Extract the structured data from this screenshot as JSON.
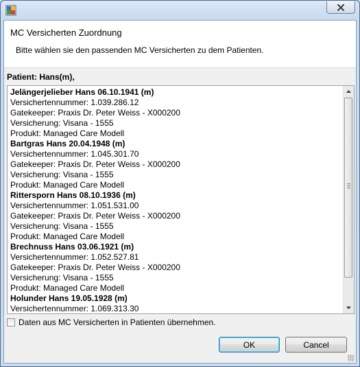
{
  "window": {
    "close_label": "×"
  },
  "header": {
    "title": "MC Versicherten Zuordnung",
    "message": "Bitte wählen sie den passenden MC Versicherten zu dem Patienten."
  },
  "patient": {
    "label": "Patient:  Hans(m),"
  },
  "list": {
    "lines": [
      {
        "text": "Jelängerjelieber Hans 06.10.1941 (m)",
        "bold": true
      },
      {
        "text": "Versichertennummer: 1.039.286.12",
        "bold": false
      },
      {
        "text": "Gatekeeper: Praxis Dr. Peter Weiss - X000200",
        "bold": false
      },
      {
        "text": "Versicherung: Visana - 1555",
        "bold": false
      },
      {
        "text": "Produkt: Managed Care Modell",
        "bold": false
      },
      {
        "text": "Bartgras Hans 20.04.1948 (m)",
        "bold": true
      },
      {
        "text": "Versichertennummer: 1.045.301.70",
        "bold": false
      },
      {
        "text": "Gatekeeper: Praxis Dr. Peter Weiss - X000200",
        "bold": false
      },
      {
        "text": "Versicherung: Visana - 1555",
        "bold": false
      },
      {
        "text": "Produkt: Managed Care Modell",
        "bold": false
      },
      {
        "text": "Rittersporn Hans 08.10.1936 (m)",
        "bold": true
      },
      {
        "text": "Versichertennummer: 1.051.531.00",
        "bold": false
      },
      {
        "text": "Gatekeeper: Praxis Dr. Peter Weiss - X000200",
        "bold": false
      },
      {
        "text": "Versicherung: Visana - 1555",
        "bold": false
      },
      {
        "text": "Produkt: Managed Care Modell",
        "bold": false
      },
      {
        "text": "Brechnuss Hans 03.06.1921 (m)",
        "bold": true
      },
      {
        "text": "Versichertennummer: 1.052.527.81",
        "bold": false
      },
      {
        "text": "Gatekeeper: Praxis Dr. Peter Weiss - X000200",
        "bold": false
      },
      {
        "text": "Versicherung: Visana - 1555",
        "bold": false
      },
      {
        "text": "Produkt: Managed Care Modell",
        "bold": false
      },
      {
        "text": "Holunder Hans 19.05.1928 (m)",
        "bold": true
      },
      {
        "text": "Versichertennummer: 1.069.313.30",
        "bold": false
      }
    ]
  },
  "checkbox": {
    "label": "Daten aus MC Versicherten in Patienten übernehmen.",
    "checked": false
  },
  "buttons": {
    "ok": "OK",
    "cancel": "Cancel"
  }
}
